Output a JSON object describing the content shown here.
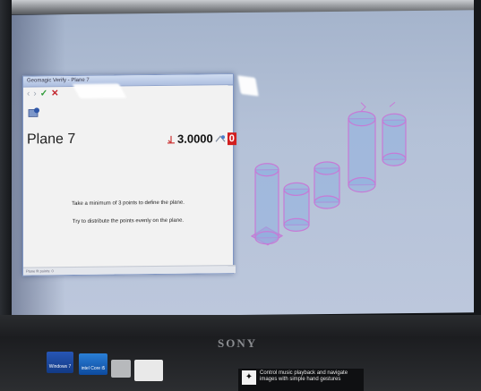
{
  "dialog": {
    "title": "Geomagic Verify - Plane 7",
    "toolbar": {
      "back_icon": "chevron-left-icon",
      "forward_icon": "chevron-right-icon",
      "ok_icon": "checkmark-icon",
      "cancel_icon": "x-icon"
    },
    "heading": "Plane 7",
    "value": "3.0000",
    "value_flag": "0",
    "instructions": [
      "Take a minimum of 3 points to define the plane.",
      "Try to distribute the points evenly on the plane."
    ],
    "status": "Plane fit points: 0"
  },
  "viewport": {
    "shape_color": "#c77ad6",
    "fill_color": "#8fb0e0"
  },
  "laptop": {
    "brand": "SONY",
    "stickers": [
      "Windows 7",
      "intel Core i5"
    ],
    "help_text": "Control music playback and navigate images with simple hand gestures"
  }
}
